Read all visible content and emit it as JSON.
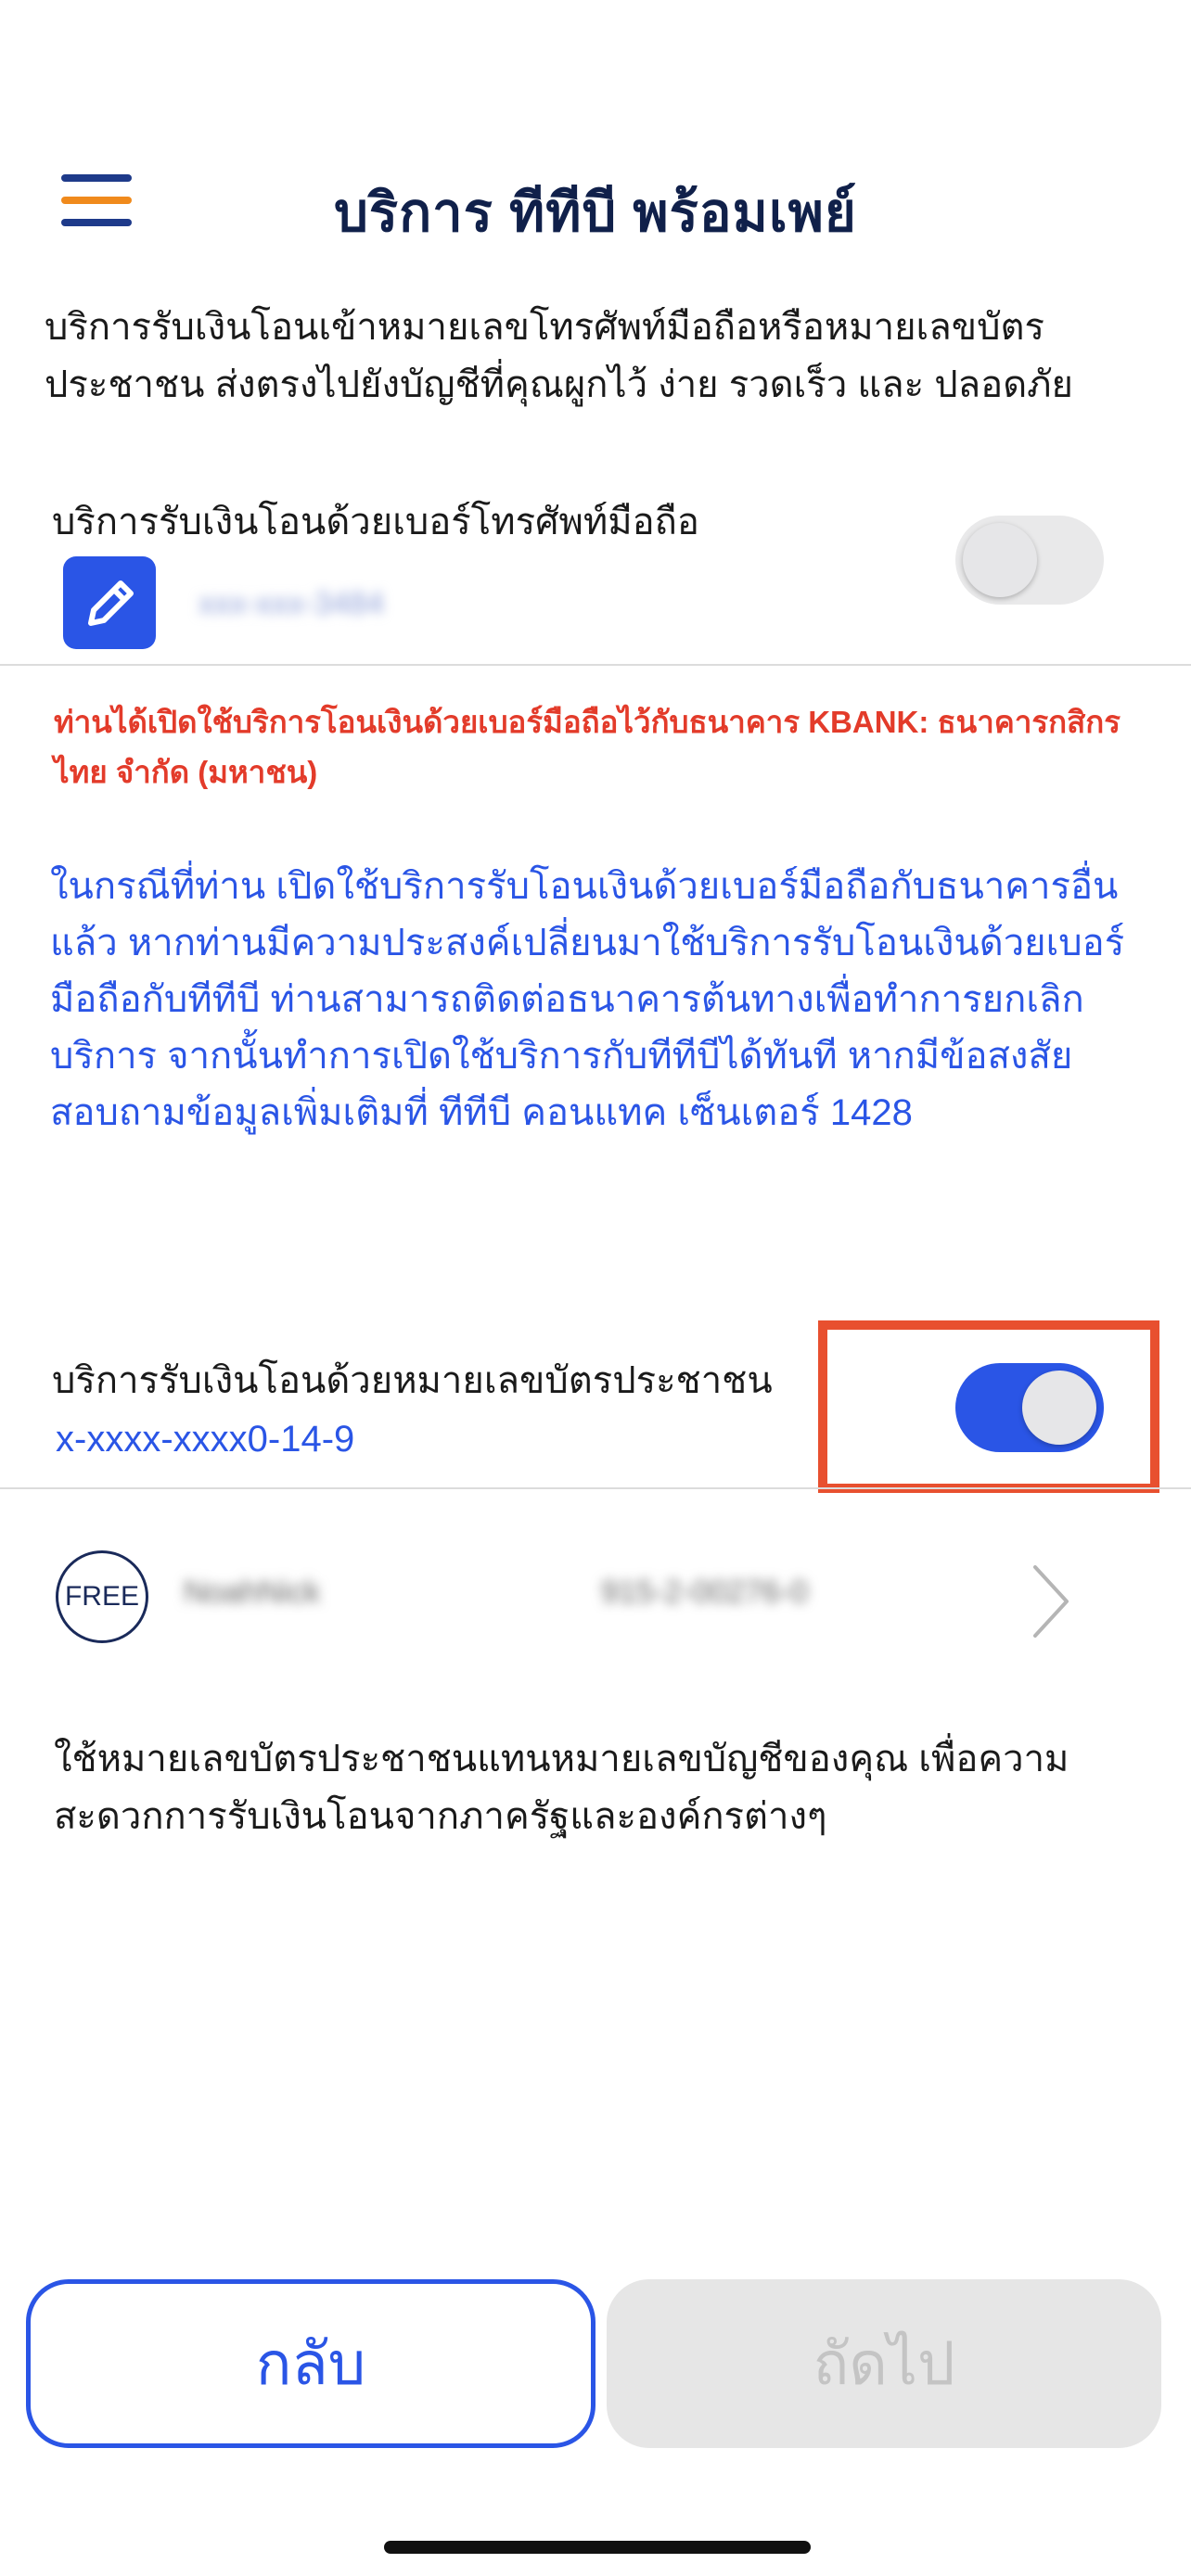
{
  "header": {
    "title": "บริการ ทีทีบี พร้อมเพย์",
    "menu_colors": [
      "#1e3a8a",
      "#f08a1c",
      "#1e3a8a"
    ]
  },
  "intro": "บริการรับเงินโอนเข้าหมายเลขโทรศัพท์มือถือหรือหมายเลขบัตรประชาชน ส่งตรงไปยังบัญชีที่คุณผูกไว้ ง่าย รวดเร็ว และ ปลอดภัย",
  "mobile_service": {
    "label": "บริการรับเงินโอนด้วยเบอร์โทรศัพท์มือถือ",
    "masked_number": "xxx-xxx-3484",
    "enabled": false,
    "edit_icon": "pencil-icon"
  },
  "warning": "ท่านได้เปิดใช้บริการโอนเงินด้วยเบอร์มือถือไว้กับธนาคาร KBANK: ธนาคารกสิกรไทย จำกัด (มหาชน)",
  "info": "ในกรณีที่ท่าน เปิดใช้บริการรับโอนเงินด้วยเบอร์มือถือกับธนาคารอื่นแล้ว หากท่านมีความประสงค์เปลี่ยนมาใช้บริการรับโอนเงินด้วยเบอร์มือถือกับทีทีบี ท่านสามารถติดต่อธนาคารต้นทางเพื่อทำการยกเลิกบริการ จากนั้นทำการเปิดใช้บริการกับทีทีบีได้ทันที หากมีข้อสงสัยสอบถามข้อมูลเพิ่มเติมที่ ทีทีบี คอนแทค เซ็นเตอร์ 1428",
  "id_service": {
    "label": "บริการรับเงินโอนด้วยหมายเลขบัตรประชาชน",
    "id_number": "x-xxxx-xxxx0-14-9",
    "enabled": true
  },
  "account": {
    "badge": "FREE",
    "name": "NoahNick",
    "number": "915-2-00276-0",
    "chevron_icon": "chevron-right-icon"
  },
  "note": "ใช้หมายเลขบัตรประชาชนแทนหมายเลขบัญชีของคุณ เพื่อความสะดวกการรับเงินโอนจากภาครัฐและองค์กรต่างๆ",
  "buttons": {
    "back": "กลับ",
    "next": "ถัดไป"
  },
  "colors": {
    "brand_blue": "#2a55e6",
    "highlight": "#e8502f",
    "warning": "#e33b2a",
    "title": "#10204a"
  }
}
